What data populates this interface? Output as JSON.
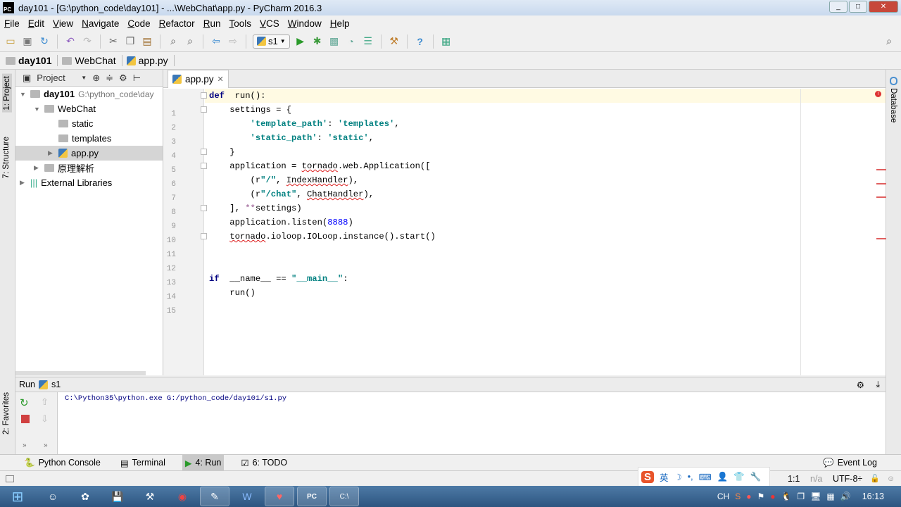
{
  "window": {
    "title": "day101 - [G:\\python_code\\day101] - ...\\WebChat\\app.py - PyCharm 2016.3",
    "logo": "PC",
    "controls": [
      "minimize",
      "maximize",
      "close"
    ]
  },
  "menu": [
    "File",
    "Edit",
    "View",
    "Navigate",
    "Code",
    "Refactor",
    "Run",
    "Tools",
    "VCS",
    "Window",
    "Help"
  ],
  "toolbar": {
    "run_config": "s1",
    "icons": [
      "open-folder",
      "save",
      "sync",
      "undo",
      "redo",
      "cut",
      "copy",
      "paste",
      "find",
      "replace",
      "back",
      "forward",
      "run",
      "debug",
      "coverage",
      "profile",
      "concurrency",
      "settings",
      "help",
      "sdk-manager",
      "search"
    ]
  },
  "breadcrumb": [
    "day101",
    "WebChat",
    "app.py"
  ],
  "side_tabs": {
    "left": [
      "1: Project",
      "7: Structure",
      "2: Favorites"
    ],
    "right": [
      "Database"
    ]
  },
  "project": {
    "header": "Project",
    "tree": [
      {
        "label": "day101",
        "path": "G:\\python_code\\day",
        "icon": "folder",
        "expanded": true
      },
      {
        "label": "WebChat",
        "icon": "folder",
        "expanded": true
      },
      {
        "label": "static",
        "icon": "folder"
      },
      {
        "label": "templates",
        "icon": "folder"
      },
      {
        "label": "app.py",
        "icon": "python-file",
        "selected": true
      },
      {
        "label": "原理解析",
        "icon": "folder"
      },
      {
        "label": "External Libraries",
        "icon": "library"
      }
    ]
  },
  "editor": {
    "tab": "app.py",
    "lines": [
      [
        [
          "kw",
          "def"
        ],
        [
          "",
          "  run():"
        ]
      ],
      [
        [
          "",
          "    settings = {"
        ]
      ],
      [
        [
          "",
          "        "
        ],
        [
          "str",
          "'template_path'"
        ],
        [
          "",
          ": "
        ],
        [
          "str",
          "'templates'"
        ],
        [
          "",
          ","
        ]
      ],
      [
        [
          "",
          "        "
        ],
        [
          "str",
          "'static_path'"
        ],
        [
          "",
          ": "
        ],
        [
          "str",
          "'static'"
        ],
        [
          "",
          ","
        ]
      ],
      [
        [
          "",
          "    }"
        ]
      ],
      [
        [
          "",
          "    application = "
        ],
        [
          "sq",
          "tornado"
        ],
        [
          "",
          ".web.Application(["
        ]
      ],
      [
        [
          "",
          "        (r"
        ],
        [
          "str",
          "\"/\""
        ],
        [
          "",
          ", "
        ],
        [
          "sq",
          "IndexHandler"
        ],
        [
          "",
          "),"
        ]
      ],
      [
        [
          "",
          "        (r"
        ],
        [
          "str",
          "\"/chat\""
        ],
        [
          "",
          ", "
        ],
        [
          "sq",
          "ChatHandler"
        ],
        [
          "",
          "),"
        ]
      ],
      [
        [
          "",
          "    ], "
        ],
        [
          "kwarg",
          "**"
        ],
        [
          "",
          "settings)"
        ]
      ],
      [
        [
          "",
          "    application.listen("
        ],
        [
          "num",
          "8888"
        ],
        [
          "",
          ")"
        ]
      ],
      [
        [
          "",
          "    "
        ],
        [
          "sq",
          "tornado"
        ],
        [
          "",
          ".ioloop.IOLoop.instance().start()"
        ]
      ],
      [],
      [],
      [
        [
          "kw",
          "if"
        ],
        [
          "",
          "  __name__ == "
        ],
        [
          "str",
          "\"__main__\""
        ],
        [
          "",
          ":"
        ]
      ],
      [
        [
          "",
          "    run()"
        ]
      ]
    ]
  },
  "run": {
    "label": "Run",
    "config": "s1",
    "output": "C:\\Python35\\python.exe G:/python_code/day101/s1.py"
  },
  "tool_tabs": [
    {
      "label": "Python Console"
    },
    {
      "label": "Terminal"
    },
    {
      "label": "4: Run",
      "active": true
    },
    {
      "label": "6: TODO"
    }
  ],
  "event_log": "Event Log",
  "status": {
    "position": "1:1",
    "na": "n/a",
    "encoding": "UTF-8÷",
    "ime": "英"
  },
  "taskbar": {
    "lang": "CH",
    "clock": "16:13"
  },
  "colors": {
    "keyword": "#000080",
    "string": "#008080",
    "number": "#0000ff",
    "current_line": "#fffae3",
    "error": "#e06060"
  }
}
